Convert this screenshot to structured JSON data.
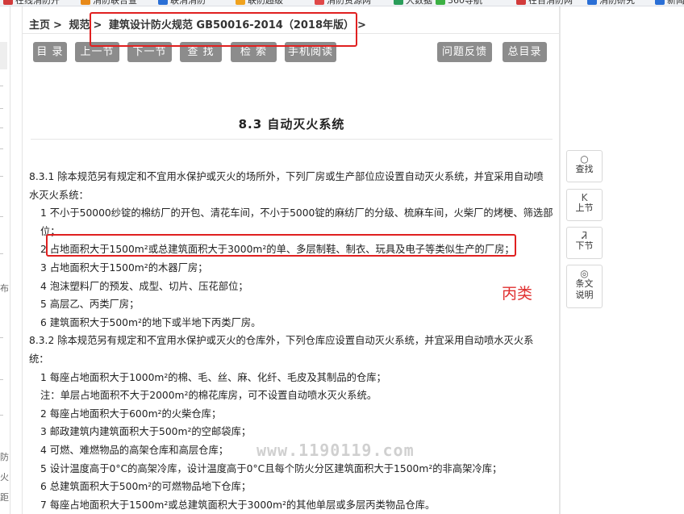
{
  "bookmarks": [
    {
      "label": "在线消防开",
      "color": "#d23b3b"
    },
    {
      "label": "消防联合查",
      "color": "#e88a1a"
    },
    {
      "label": "联消消防",
      "color": "#2a6fd6"
    },
    {
      "label": "联防超级",
      "color": "#f0a21e"
    },
    {
      "label": "消防资源网",
      "color": "#e04848"
    },
    {
      "label": "大数据",
      "color": "#2a9d5a"
    },
    {
      "label": "360导航",
      "color": "#3cb043"
    },
    {
      "label": "在百消防网",
      "color": "#d23b3b"
    },
    {
      "label": "消防研究",
      "color": "#2a6fd6"
    },
    {
      "label": "新闻",
      "color": "#2a6fd6"
    }
  ],
  "left_strip": {
    "chars": [
      "布",
      "防",
      "火",
      "距"
    ]
  },
  "breadcrumb": {
    "home": "主页",
    "sep1": ">",
    "section": "规范",
    "sep2": ">",
    "current": "建筑设计防火规范 GB50016-2014（2018年版）",
    "sep3": ">"
  },
  "toolbar": {
    "buttons": [
      "目 录",
      "上一节",
      "下一节",
      "查 找",
      "检 索",
      "手机阅读"
    ],
    "feedback": "问题反馈",
    "catalog": "总目录"
  },
  "section_title": "8.3 自动灭火系统",
  "content": [
    "8.3.1 除本规范另有规定和不宜用水保护或灭火的场所外，下列厂房或生产部位应设置自动灭火系统，并宜采用自动喷水灭火系统：",
    "1 不小于50000纱锭的棉纺厂的开包、清花车间，不小于5000锭的麻纺厂的分级、梳麻车间，火柴厂的烤梗、筛选部位；",
    "2 占地面积大于1500m²或总建筑面积大于3000m²的单、多层制鞋、制衣、玩具及电子等类似生产的厂房；",
    "3 占地面积大于1500m²的木器厂房；",
    "4 泡沫塑料厂的预发、成型、切片、压花部位；",
    "5 高层乙、丙类厂房；",
    "6 建筑面积大于500m²的地下或半地下丙类厂房。",
    "8.3.2 除本规范另有规定和不宜用水保护或灭火的仓库外，下列仓库应设置自动灭火系统，并宜采用自动喷水灭火系统：",
    "1 每座占地面积大于1000m²的棉、毛、丝、麻、化纤、毛皮及其制品的仓库；",
    "注：单层占地面积不大于2000m²的棉花库房，可不设置自动喷水灭火系统。",
    "2 每座占地面积大于600m²的火柴仓库；",
    "3 邮政建筑内建筑面积大于500m²的空邮袋库；",
    "4 可燃、难燃物品的高架仓库和高层仓库；",
    "5 设计温度高于0°C的高架冷库，设计温度高于0°C且每个防火分区建筑面积大于1500m²的非高架冷库；",
    "6 总建筑面积大于500m²的可燃物品地下仓库；",
    "7 每座占地面积大于1500m²或总建筑面积大于3000m²的其他单层或多层丙类物品仓库。"
  ],
  "tools": [
    {
      "icon": "○",
      "label": "查找"
    },
    {
      "icon": "K",
      "label": "上节"
    },
    {
      "icon": "Ꮨ",
      "label": "下节"
    },
    {
      "icon": "◎",
      "label": "条文说明"
    }
  ],
  "annotation_note": "丙类",
  "watermark": "www.1190119.com"
}
